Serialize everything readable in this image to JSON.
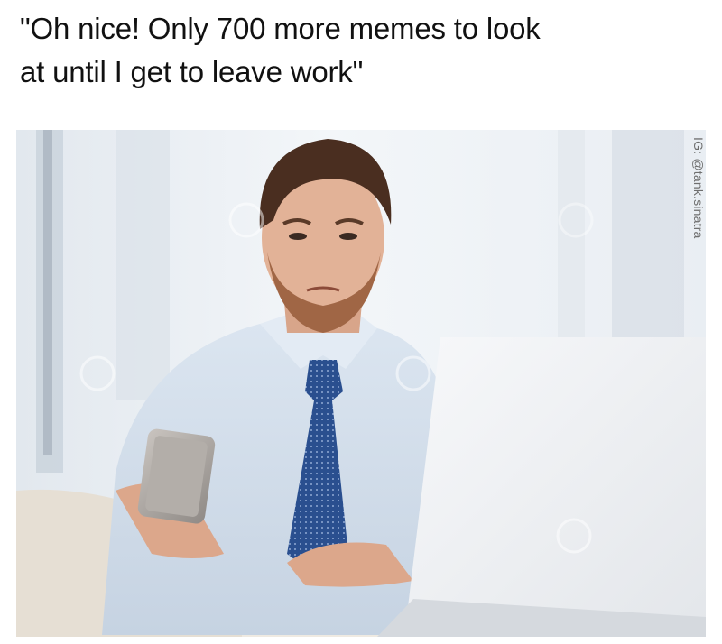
{
  "caption": {
    "line1": "\"Oh nice! Only 700 more memes to look",
    "line2": "at until I get to leave work\""
  },
  "watermark": {
    "handle": "IG: @tank.sinatra"
  },
  "photo": {
    "subject": "man-looking-at-phone-at-desk"
  }
}
